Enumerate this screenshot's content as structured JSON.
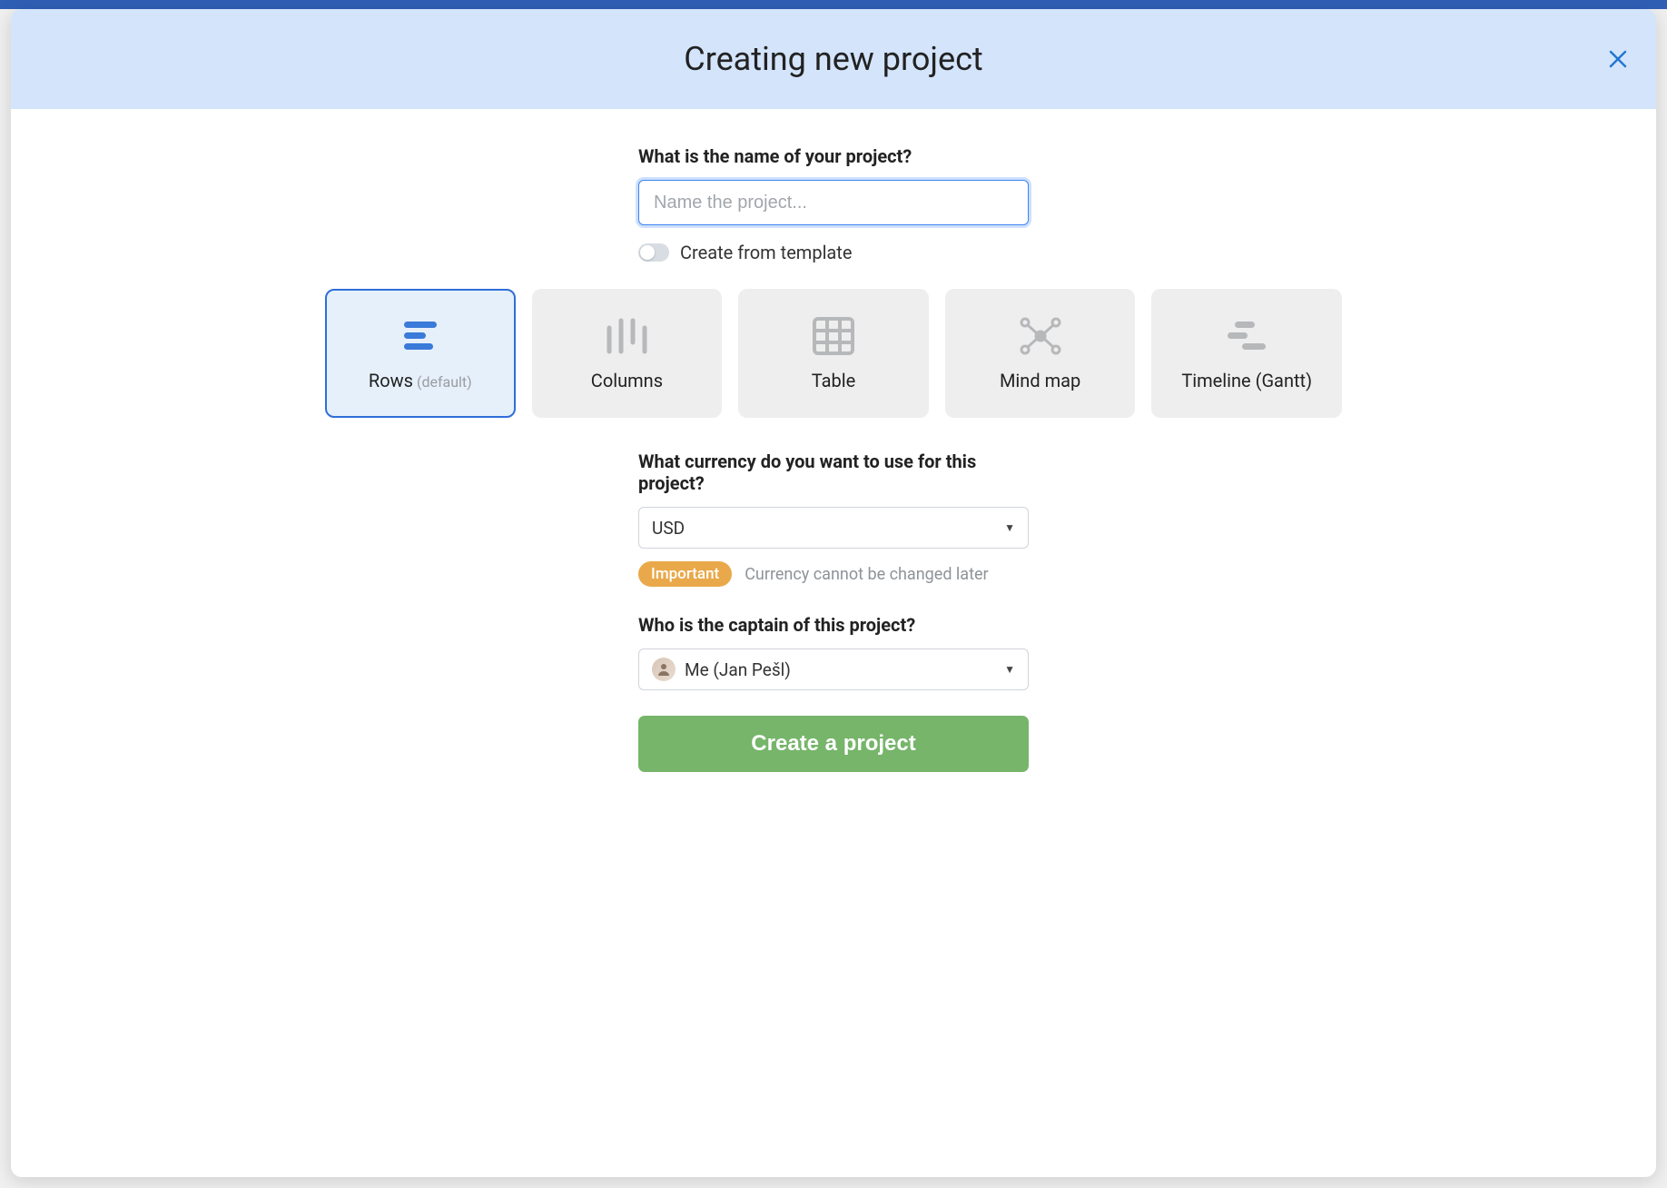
{
  "modal": {
    "title": "Creating new project",
    "name_question": "What is the name of your project?",
    "name_placeholder": "Name the project...",
    "template_toggle_label": "Create from template",
    "currency_question": "What currency do you want to use for this project?",
    "currency_value": "USD",
    "currency_badge": "Important",
    "currency_note": "Currency cannot be changed later",
    "captain_question": "Who is the captain of this project?",
    "captain_value": "Me (Jan Pešl)",
    "submit_label": "Create a project"
  },
  "layouts": [
    {
      "label": "Rows",
      "sub": "(default)",
      "selected": true
    },
    {
      "label": "Columns",
      "selected": false
    },
    {
      "label": "Table",
      "selected": false
    },
    {
      "label": "Mind map",
      "selected": false
    },
    {
      "label": "Timeline (Gantt)",
      "selected": false
    }
  ]
}
